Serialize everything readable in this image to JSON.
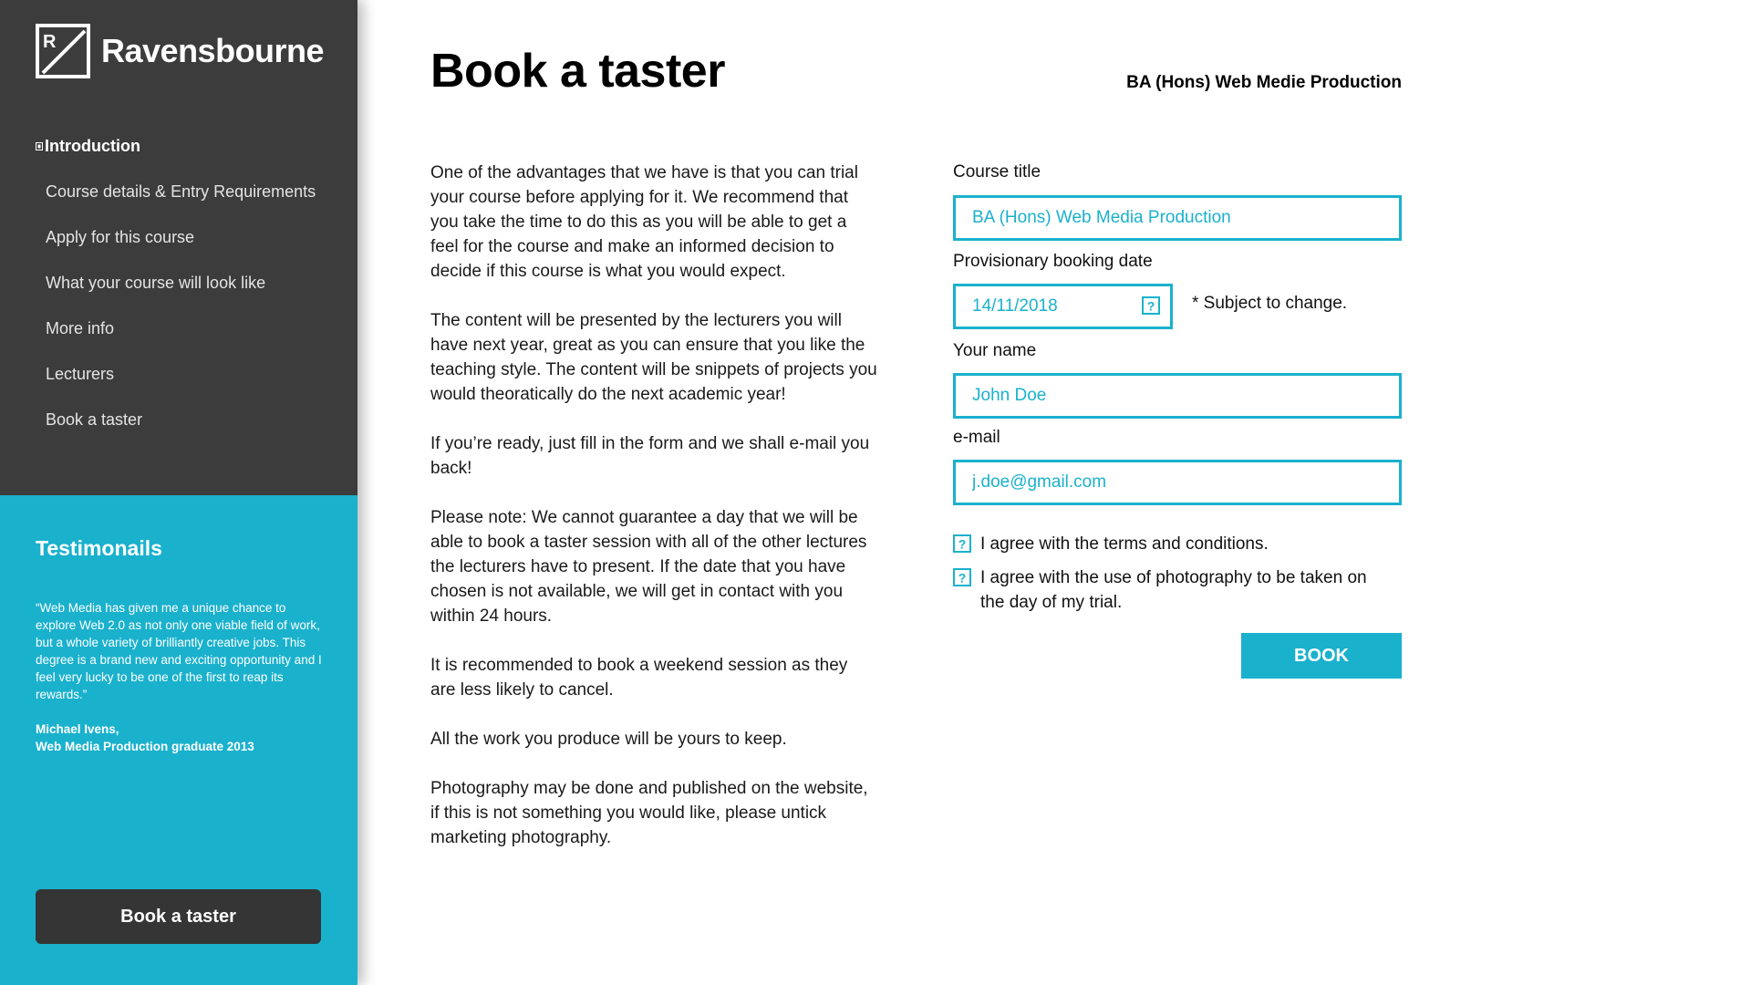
{
  "brand": {
    "name": "Ravensbourne",
    "logo_letter": "R",
    "accent_color": "#1ab1cd",
    "sidebar_color": "#3c3c3c"
  },
  "sidebar": {
    "nav": [
      {
        "label": "Introduction",
        "active": true,
        "icon": "bullet-icon"
      },
      {
        "label": "Course details & Entry Requirements"
      },
      {
        "label": "Apply for this course"
      },
      {
        "label": "What your course will look like"
      },
      {
        "label": "More info"
      },
      {
        "label": "Lecturers"
      },
      {
        "label": "Book a taster"
      }
    ],
    "testimonial": {
      "title": "Testimonails",
      "quote": "“Web Media has given me a unique chance to explore Web 2.0 as not only one viable field of work, but a whole variety of brilliantly creative jobs. This degree is a brand new and exciting opportunity and I feel very lucky to be one of the first to reap its rewards.”",
      "author_name": "Michael Ivens,",
      "author_role": "Web Media Production graduate 2013"
    },
    "book_button": "Book a taster"
  },
  "main": {
    "title": "Book a taster",
    "course_subtitle": "BA (Hons) Web Medie Production",
    "paragraphs": [
      "One of the advantages that we have is that you can trial your course before applying for it. We recommend that you take the time to do this as you will be able to get a feel for the course and make an informed decision to decide if this course is what you would expect.",
      "The content will be presented by the lecturers you will have next year, great as you can ensure that you like the teaching style. The content will be snippets of projects you would theoratically do the next academic year!",
      "If you’re ready, just fill in the form and we shall e-mail you back!",
      "Please note: We cannot guarantee a day that we will be able to book a taster session with all of the other lectures the lecturers have to present. If the date that you have chosen is not available, we will get in contact with you within 24 hours.",
      "It is recommended to book a weekend session as they are less likely to cancel.",
      "All the work you produce will be yours to keep.",
      "Photography may be done and published on the website, if this is not something you would like, please untick marketing photography."
    ]
  },
  "form": {
    "course_title_label": "Course title",
    "course_title_placeholder": "BA (Hons) Web Media Production",
    "date_label": "Provisionary booking date",
    "date_placeholder": "14/11/2018",
    "date_icon": "calendar-help-icon",
    "date_note": "* Subject to change.",
    "name_label": "Your name",
    "name_placeholder": "John Doe",
    "email_label": "e-mail",
    "email_placeholder": "j.doe@gmail.com",
    "checkbox_terms": "I agree with the terms and conditions.",
    "checkbox_photo": "I agree with the use of photography to be taken on the day of my trial.",
    "submit_label": "BOOK"
  }
}
